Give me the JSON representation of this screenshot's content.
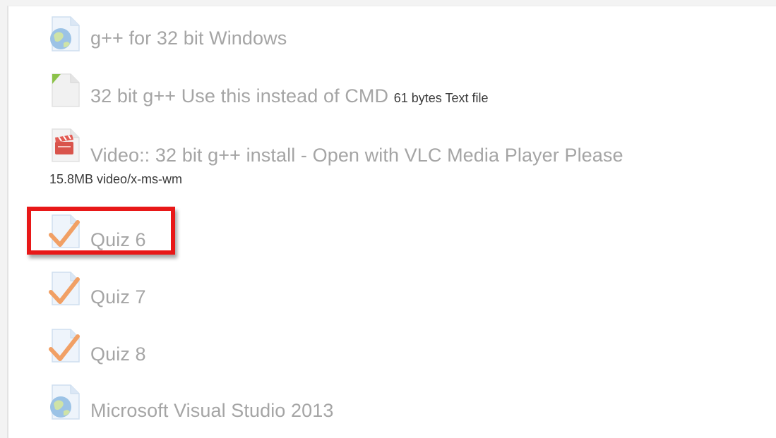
{
  "items": [
    {
      "name": "g++ for 32 bit Windows",
      "icon": "url-globe-icon"
    },
    {
      "name": "32 bit g++ Use this instead of CMD",
      "meta": "61 bytes Text file",
      "icon": "text-file-icon"
    },
    {
      "name": "Video:: 32 bit g++ install - Open with VLC Media Player Please",
      "meta": "15.8MB video/x-ms-wm",
      "icon": "video-file-icon"
    },
    {
      "name": "Quiz 6",
      "icon": "quiz-check-icon"
    },
    {
      "name": "Quiz 7",
      "icon": "quiz-check-icon"
    },
    {
      "name": "Quiz 8",
      "icon": "quiz-check-icon"
    },
    {
      "name": "Microsoft Visual Studio 2013",
      "icon": "url-globe-icon"
    }
  ],
  "highlight": {
    "target": "Quiz 6",
    "color": "#e81818"
  },
  "colors": {
    "link_text": "#a5a5a5",
    "meta_text": "#3a3a3a",
    "check": "#f1a065",
    "page_icon": "#dce9f7"
  }
}
